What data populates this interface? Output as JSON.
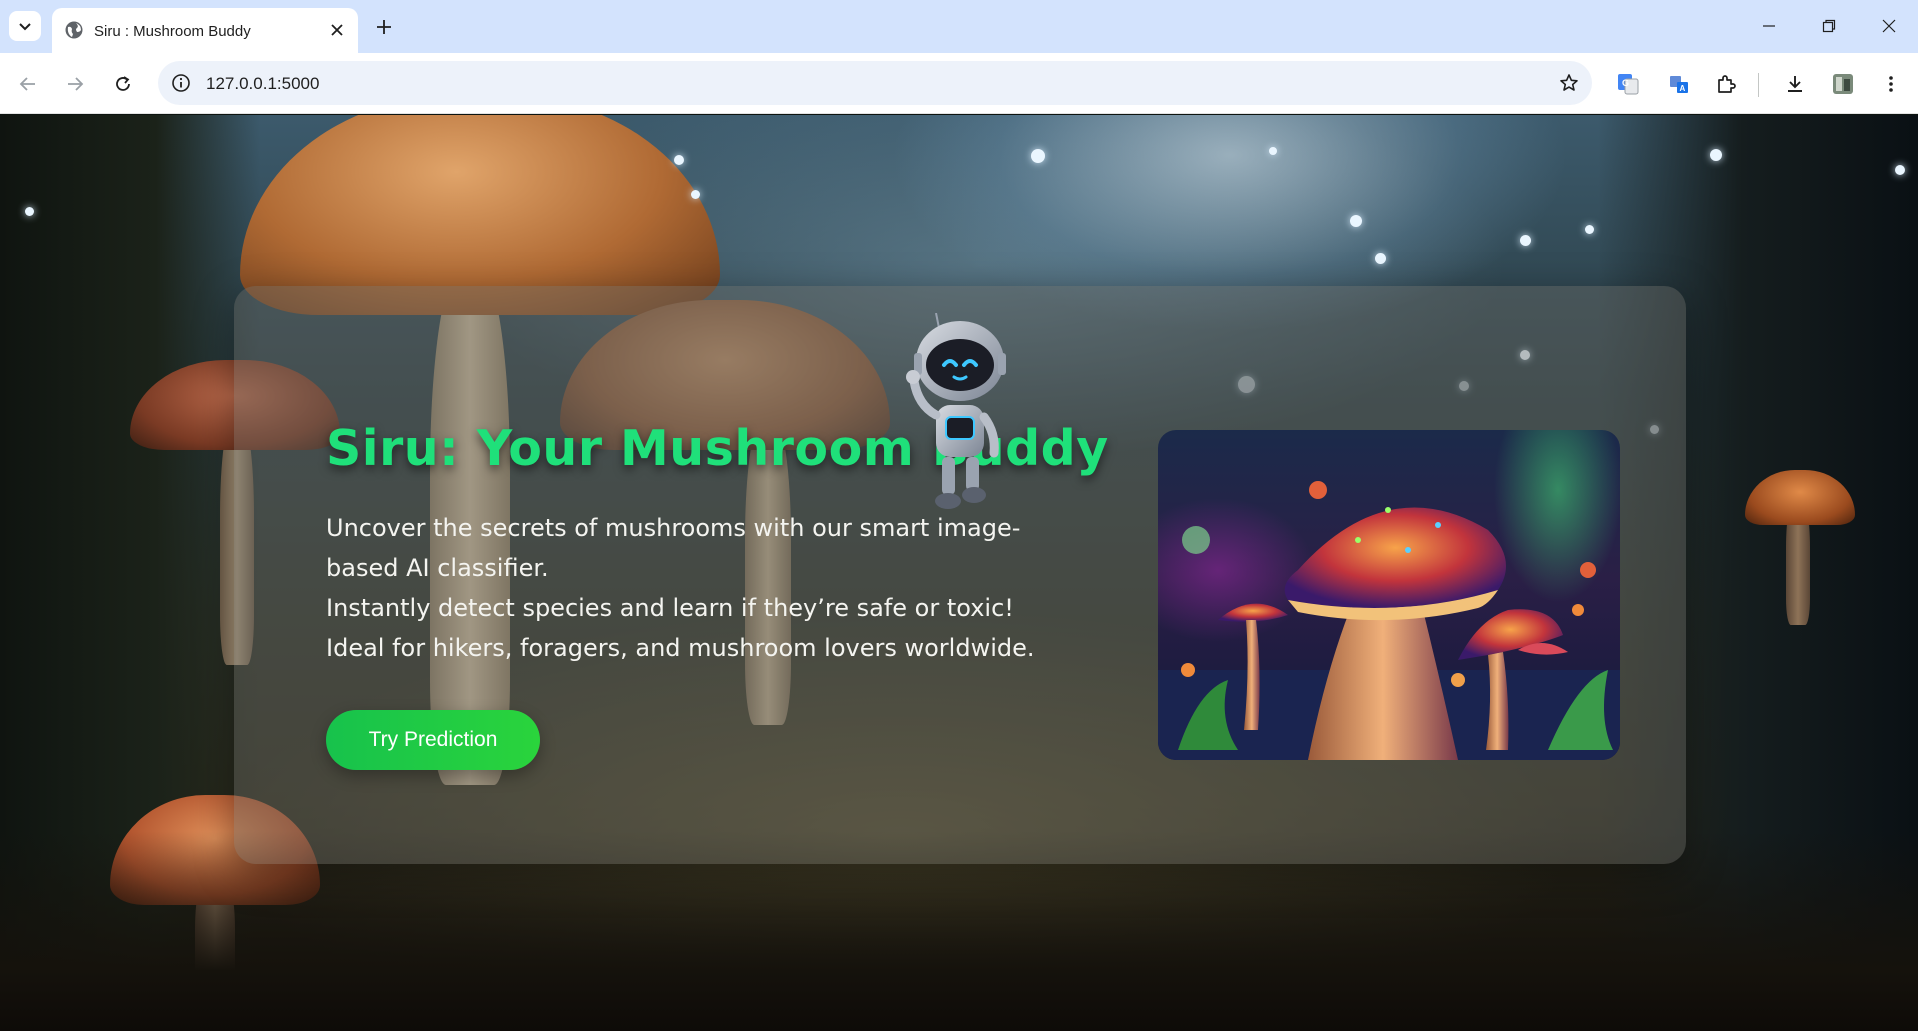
{
  "browser": {
    "tab_title": "Siru : Mushroom Buddy",
    "url": "127.0.0.1:5000"
  },
  "hero": {
    "title": "Siru: Your Mushroom Buddy",
    "description_lines": [
      "Uncover the secrets of mushrooms with our smart image-based AI classifier.",
      "Instantly detect species and learn if they’re safe or toxic!",
      "Ideal for hikers, foragers, and mushroom lovers worldwide."
    ],
    "cta_label": "Try Prediction"
  },
  "colors": {
    "title_green": "#1fe07a",
    "cta_green": "#1fc846",
    "tabstrip": "#d3e3fd"
  },
  "icons": [
    "tab-list-icon",
    "globe-icon",
    "close-icon",
    "plus-icon",
    "minimize-icon",
    "restore-icon",
    "window-close-icon",
    "back-arrow-icon",
    "forward-arrow-icon",
    "reload-icon",
    "site-info-icon",
    "star-icon",
    "google-translate-icon",
    "translate-icon",
    "extensions-icon",
    "download-icon",
    "profile-avatar-icon",
    "more-menu-icon"
  ]
}
